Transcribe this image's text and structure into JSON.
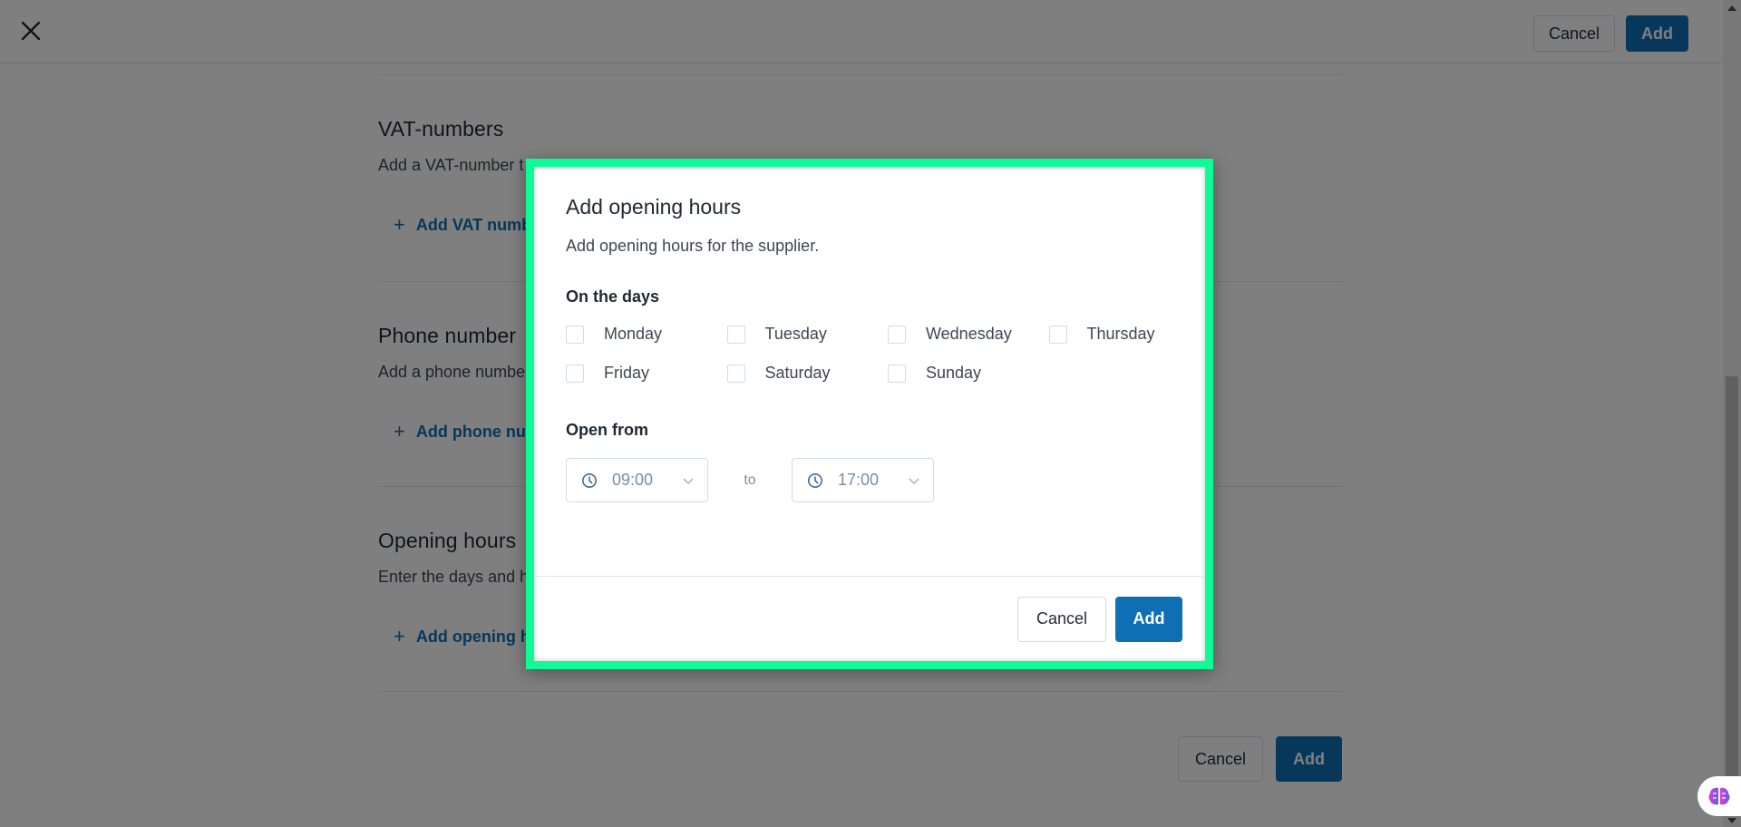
{
  "page": {
    "header": {
      "close_icon": "close-icon",
      "cancel_label": "Cancel",
      "add_label": "Add"
    },
    "sections": [
      {
        "title": "VAT-numbers",
        "description": "Add a VAT-number t",
        "add_label": "Add VAT numb",
        "add_icon": "plus-icon"
      },
      {
        "title": "Phone number",
        "description": "Add a phone numbe",
        "add_label": "Add phone nu",
        "add_icon": "plus-icon"
      },
      {
        "title": "Opening hours",
        "description": "Enter the days and h",
        "add_label": "Add opening h",
        "add_icon": "plus-icon"
      }
    ],
    "footer": {
      "cancel_label": "Cancel",
      "add_label": "Add"
    },
    "assistant_icon": "brain-icon"
  },
  "dialog": {
    "title": "Add opening hours",
    "subtitle": "Add opening hours for the supplier.",
    "days_label": "On the days",
    "days": [
      {
        "label": "Monday",
        "checked": false
      },
      {
        "label": "Tuesday",
        "checked": false
      },
      {
        "label": "Wednesday",
        "checked": false
      },
      {
        "label": "Thursday",
        "checked": false
      },
      {
        "label": "Friday",
        "checked": false
      },
      {
        "label": "Saturday",
        "checked": false
      },
      {
        "label": "Sunday",
        "checked": false
      }
    ],
    "open_from_label": "Open from",
    "from_time": "09:00",
    "to_label": "to",
    "to_time": "17:00",
    "time_icon": "clock-icon",
    "dropdown_icon": "chevron-down-icon",
    "cancel_label": "Cancel",
    "add_label": "Add"
  },
  "colors": {
    "primary": "#0f6fb4",
    "highlight_border": "#0efc95",
    "overlay": "rgba(0,0,0,0.5)"
  }
}
